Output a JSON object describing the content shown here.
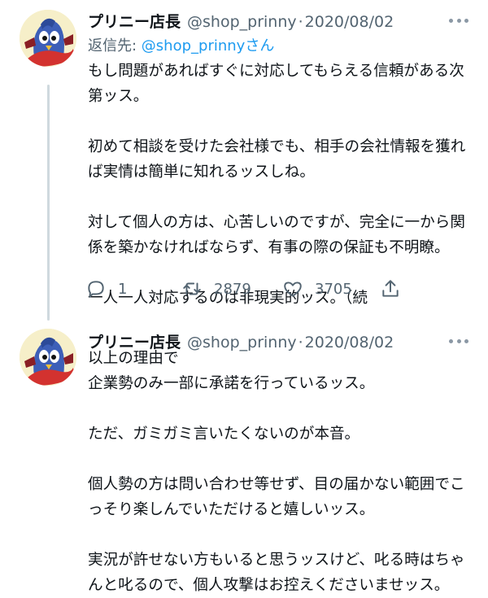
{
  "tweets": [
    {
      "display_name": "プリニー店長",
      "handle": "@shop_prinny",
      "separator": "·",
      "date": "2020/08/02",
      "reply_prefix": "返信先: ",
      "reply_mention": "@shop_prinny",
      "reply_suffix": "さん",
      "lines": [
        "もし問題があればすぐに対応してもらえる信頼がある次",
        "第ッス。",
        "",
        "初めて相談を受けた会社様でも、相手の会社情報を獲れ",
        "ば実情は簡単に知れるッスしね。",
        "",
        "対して個人の方は、心苦しいのですが、完全に一から関",
        "係を築かなければならず、有事の際の保証も不明瞭。",
        "",
        "一人一人対応するのは非現実的ッス。（続"
      ],
      "reply_count": "1",
      "retweet_count": "2879",
      "like_count": "3705"
    },
    {
      "display_name": "プリニー店長",
      "handle": "@shop_prinny",
      "separator": "·",
      "date": "2020/08/02",
      "lines": [
        "以上の理由で",
        "企業勢のみ一部に承諾を行っているッス。",
        "",
        "ただ、ガミガミ言いたくないのが本音。",
        "",
        "個人勢の方は問い合わせ等せず、目の届かない範囲でこ",
        "っそり楽しんでいただけると嬉しいッス。",
        "",
        "実況が許せない方もいると思うッスけど、叱る時はちゃ",
        "んと叱るので、個人攻撃はお控えくださいませッス。"
      ]
    }
  ],
  "icons": {
    "avatar": "prinny-penguin-avatar",
    "more": "more-horizontal-icon",
    "reply": "reply-bubble-icon",
    "retweet": "retweet-icon",
    "like": "heart-icon",
    "share": "share-upload-icon"
  },
  "colors": {
    "text": "#0f1419",
    "secondary": "#536471",
    "link": "#1d9bf0",
    "thread_line": "#cfd9de"
  }
}
